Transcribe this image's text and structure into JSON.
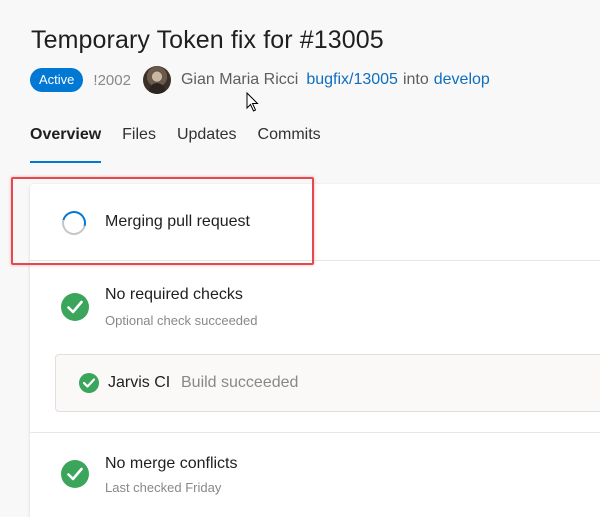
{
  "pr": {
    "title": "Temporary Token fix for #13005",
    "status_badge": "Active",
    "id": "!2002",
    "author": "Gian Maria Ricci",
    "source_branch": "bugfix/13005",
    "into_text": "into",
    "target_branch": "develop"
  },
  "tabs": [
    {
      "label": "Overview"
    },
    {
      "label": "Files"
    },
    {
      "label": "Updates"
    },
    {
      "label": "Commits"
    }
  ],
  "status": {
    "merging": "Merging pull request",
    "checks_title": "No required checks",
    "checks_sub": "Optional check succeeded",
    "build_name": "Jarvis CI",
    "build_status": "Build succeeded",
    "conflicts_title": "No merge conflicts",
    "conflicts_sub": "Last checked Friday"
  },
  "colors": {
    "accent": "#0078d4",
    "success": "#3ba55c",
    "highlight": "#e5484d"
  }
}
